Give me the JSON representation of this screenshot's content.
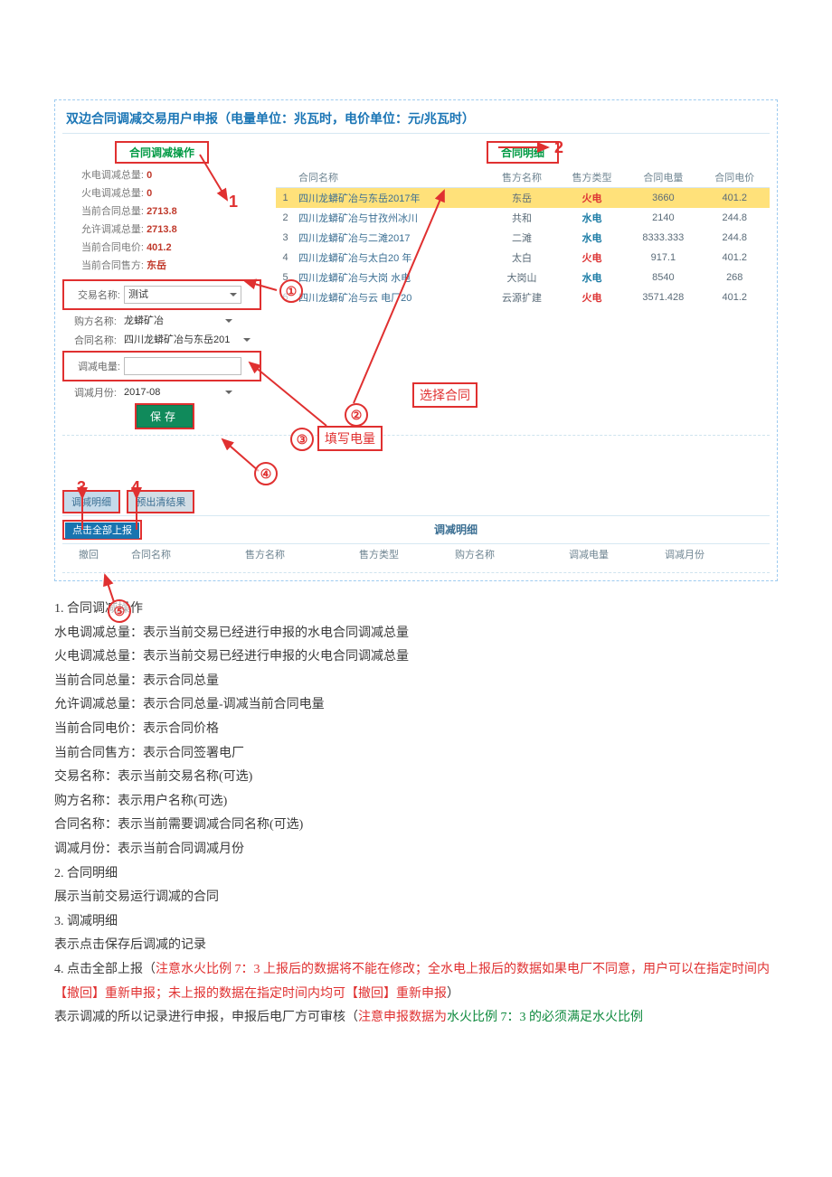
{
  "app": {
    "title": "双边合同调减交易用户申报（电量单位：兆瓦时，电价单位：元/兆瓦时）",
    "opsHeader": "合同调减操作",
    "detailHeader": "合同明细",
    "stats": {
      "hydroLabel": "水电调减总量:",
      "hydroVal": "0",
      "thermalLabel": "火电调减总量:",
      "thermalVal": "0",
      "curTotalLabel": "当前合同总量:",
      "curTotalVal": "2713.8",
      "allowLabel": "允许调减总量:",
      "allowVal": "2713.8",
      "curPriceLabel": "当前合同电价:",
      "curPriceVal": "401.2",
      "curSellerLabel": "当前合同售方:",
      "curSellerVal": "东岳"
    },
    "form": {
      "tradeNameLabel": "交易名称:",
      "tradeName": "测试",
      "buyerLabel": "购方名称:",
      "buyer": "龙蟒矿冶",
      "contractLabel": "合同名称:",
      "contract": "四川龙蟒矿冶与东岳201",
      "reduceLabel": "调减电量:",
      "reduceVal": "",
      "monthLabel": "调减月份:",
      "monthVal": "2017-08",
      "saveLabel": "保存"
    },
    "th": {
      "idx": "",
      "name": "合同名称",
      "seller": "售方名称",
      "type": "售方类型",
      "qty": "合同电量",
      "price": "合同电价"
    },
    "rows": [
      {
        "idx": "1",
        "name": "四川龙蟒矿冶与东岳2017年",
        "seller": "东岳",
        "type": "火电",
        "qty": "3660",
        "price": "401.2",
        "sel": true,
        "fire": true
      },
      {
        "idx": "2",
        "name": "四川龙蟒矿冶与甘孜州冰川",
        "seller": "共和",
        "type": "水电",
        "qty": "2140",
        "price": "244.8"
      },
      {
        "idx": "3",
        "name": "四川龙蟒矿冶与二滩2017",
        "seller": "二滩",
        "type": "水电",
        "qty": "8333.333",
        "price": "244.8"
      },
      {
        "idx": "4",
        "name": "四川龙蟒矿冶与太白20   年",
        "seller": "太白",
        "type": "火电",
        "qty": "917.1",
        "price": "401.2",
        "fire": true
      },
      {
        "idx": "5",
        "name": "四川龙蟒矿冶与大岗  水电",
        "seller": "大岗山",
        "type": "水电",
        "qty": "8540",
        "price": "268"
      },
      {
        "idx": "6",
        "name": "四川龙蟒矿冶与云   电厂20",
        "seller": "云源扩建",
        "type": "火电",
        "qty": "3571.428",
        "price": "401.2",
        "fire": true
      }
    ],
    "tabs": {
      "t1": "调减明细",
      "t2": "预出清结果"
    },
    "reportBtn": "点击全部上报",
    "detailTitle": "调减明细",
    "detailCols": {
      "c1": "撤回",
      "c2": "合同名称",
      "c3": "售方名称",
      "c4": "售方类型",
      "c5": "购方名称",
      "c6": "调减电量",
      "c7": "调减月份"
    }
  },
  "anno": {
    "n1": "1",
    "n2": "2",
    "n3": "3",
    "n4": "4",
    "n5": "5",
    "c1": "①",
    "c2": "②",
    "c3": "③",
    "c4": "④",
    "c5": "⑤",
    "selectContract": "选择合同",
    "fillQty": "填写电量"
  },
  "explain": {
    "h1": "1. 合同调减操作",
    "p1": "水电调减总量：表示当前交易已经进行申报的水电合同调减总量",
    "p2": "火电调减总量：表示当前交易已经进行申报的火电合同调减总量",
    "p3": "当前合同总量：表示合同总量",
    "p4": "允许调减总量：表示合同总量-调减当前合同电量",
    "p5": "当前合同电价：表示合同价格",
    "p6": "当前合同售方：表示合同签署电厂",
    "p7": "交易名称：表示当前交易名称(可选)",
    "p8": "购方名称：表示用户名称(可选)",
    "p9": "合同名称：表示当前需要调减合同名称(可选)",
    "p10": "调减月份：表示当前合同调减月份",
    "h2": "2. 合同明细",
    "p11": "展示当前交易运行调减的合同",
    "h3": "3. 调减明细",
    "p12": "表示点击保存后调减的记录",
    "h4_a": "4. 点击全部上报（",
    "h4_b": "注意水火比例 7：3 上报后的数据将不能在修改；全水电上报后的数据如果电厂不同意，用户可以在指定时间内【撤回】重新申报；未上报的数据在指定时间内均可【撤回】重新申报",
    "h4_c": "）",
    "p13_a": "表示调减的所以记录进行申报，申报后电厂方可审核（",
    "p13_b": "注意申报数据为",
    "p13_c": "水火比例 7：3 的必须满足水火比例"
  }
}
